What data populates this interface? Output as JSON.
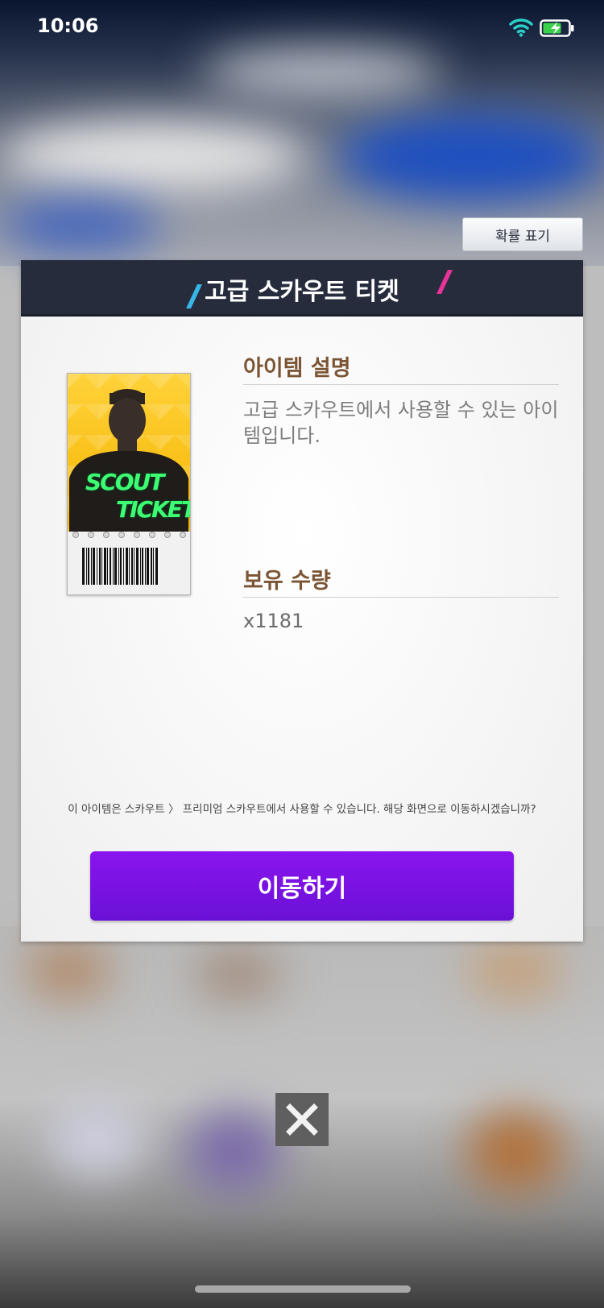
{
  "status_bar": {
    "time": "10:06",
    "icons": [
      "wifi-icon",
      "battery-charging-icon"
    ],
    "wifi_color": "#2ad0c8",
    "battery_color": "#3bd14b"
  },
  "probability_button": {
    "label": "확률 표기"
  },
  "dialog": {
    "title": "고급 스카우트 티켓",
    "item_image": {
      "line1": "SCOUT",
      "line2": "TICKET",
      "background_color": "#f8c21a",
      "text_color": "#3dff74"
    },
    "description_label": "아이템 설명",
    "description_text": "고급 스카우트에서 사용할 수 있는 아이템입니다.",
    "quantity_label": "보유 수량",
    "quantity_value": "x1181",
    "notice": "이 아이템은 스카우트 〉 프리미엄 스카우트에서 사용할 수 있습니다. 해당 화면으로 이동하시겠습니까?",
    "move_button_label": "이동하기",
    "accent_color": "#7a12e6",
    "header_color": "#262c3c"
  },
  "close_button": {
    "icon": "close-icon"
  }
}
